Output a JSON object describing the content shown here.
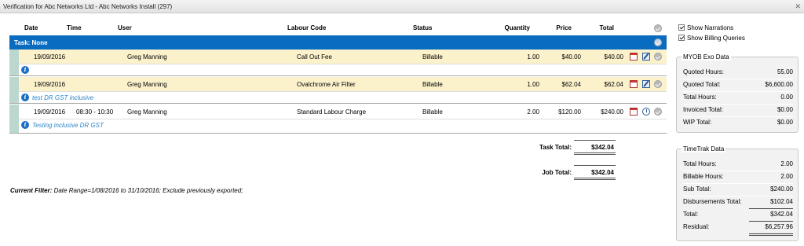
{
  "window": {
    "title": "Verification for Abc Networks Ltd - Abc Networks Install (297)"
  },
  "columns": {
    "date": "Date",
    "time": "Time",
    "user": "User",
    "labour_code": "Labour Code",
    "status": "Status",
    "quantity": "Quantity",
    "price": "Price",
    "total": "Total"
  },
  "task": {
    "label": "Task: None"
  },
  "entries": [
    {
      "date": "19/09/2016",
      "time": "",
      "user": "Greg Manning",
      "labour_code": "Call Out Fee",
      "status": "Billable",
      "quantity": "1.00",
      "price": "$40.00",
      "total": "$40.00",
      "narration": ""
    },
    {
      "date": "19/09/2016",
      "time": "",
      "user": "Greg Manning",
      "labour_code": "Ovalchrome Air Filter",
      "status": "Billable",
      "quantity": "1.00",
      "price": "$62.04",
      "total": "$62.04",
      "narration": "test DR GST inclusive"
    },
    {
      "date": "19/09/2016",
      "time": "08:30 - 10:30",
      "user": "Greg Manning",
      "labour_code": "Standard Labour Charge",
      "status": "Billable",
      "quantity": "2.00",
      "price": "$120.00",
      "total": "$240.00",
      "narration": "Testing inclusive DR GST"
    }
  ],
  "totals": {
    "task_label": "Task Total:",
    "task_value": "$342.04",
    "job_label": "Job Total:",
    "job_value": "$342.04"
  },
  "filter": {
    "label": "Current Filter:",
    "text": "Date Range=1/08/2016 to 31/10/2016; Exclude previously exported;"
  },
  "options": {
    "show_narrations": "Show Narrations",
    "show_billing_queries": "Show Billing Queries"
  },
  "myob": {
    "title": "MYOB Exo Data",
    "rows": [
      {
        "label": "Quoted Hours:",
        "value": "55.00"
      },
      {
        "label": "Quoted Total:",
        "value": "$6,600.00"
      },
      {
        "label": "Total Hours:",
        "value": "0.00"
      },
      {
        "label": "Invoiced Total:",
        "value": "$0.00"
      },
      {
        "label": "WIP Total:",
        "value": "$0.00"
      }
    ]
  },
  "timetrak": {
    "title": "TimeTrak Data",
    "rows": [
      {
        "label": "Total Hours:",
        "value": "2.00"
      },
      {
        "label": "Billable Hours:",
        "value": "2.00"
      },
      {
        "label": "Sub Total:",
        "value": "$240.00"
      },
      {
        "label": "Disbursements Total:",
        "value": "$102.04"
      },
      {
        "label": "Total:",
        "value": "$342.04"
      },
      {
        "label": "Residual:",
        "value": "$6,257.96"
      }
    ]
  },
  "colors": {
    "task_bar": "#0a6cbf",
    "row_highlight": "#fbf2cc",
    "narration": "#2b86c8"
  },
  "icons": [
    "close-icon",
    "approve-all-icon",
    "info-icon",
    "calendar-icon",
    "edit-icon",
    "clock-icon",
    "approve-icon"
  ]
}
